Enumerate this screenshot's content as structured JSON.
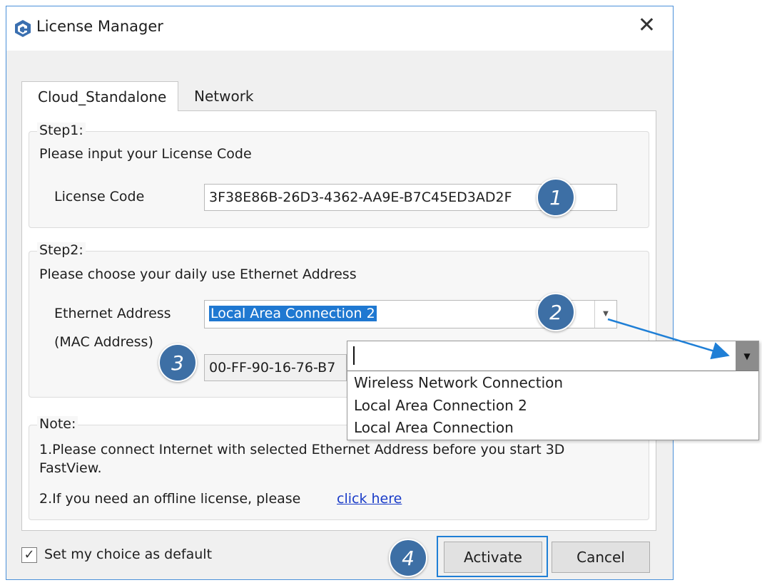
{
  "window": {
    "title": "License Manager",
    "close_icon": "close-icon"
  },
  "tabs": [
    {
      "label": "Cloud_Standalone",
      "active": true
    },
    {
      "label": "Network",
      "active": false
    }
  ],
  "step1": {
    "legend": "Step1:",
    "instruction": "Please input your License Code",
    "license_label": "License Code",
    "license_value": "3F38E86B-26D3-4362-AA9E-B7C45ED3AD2F"
  },
  "step2": {
    "legend": "Step2:",
    "instruction": "Please choose your daily use Ethernet Address",
    "ethernet_label": "Ethernet Address",
    "mac_label": "(MAC Address)",
    "ethernet_selected": "Local Area Connection 2",
    "mac_value": "00-FF-90-16-76-B7"
  },
  "dropdown": {
    "input_value": "",
    "options": [
      "Wireless Network Connection",
      "Local Area Connection 2",
      "Local Area Connection"
    ]
  },
  "note": {
    "legend": "Note:",
    "line1": "1.Please connect Internet with selected Ethernet Address before you start 3D",
    "line1b": "FastView.",
    "line2": "2.If you need an offline license, please",
    "link": "click here"
  },
  "footer": {
    "checkbox_label": "Set my choice as default",
    "checkbox_checked": true,
    "activate_label": "Activate",
    "cancel_label": "Cancel"
  },
  "badges": [
    "1",
    "2",
    "3",
    "4"
  ],
  "colors": {
    "badge": "#3d6fa5",
    "selection": "#1f78d1",
    "link": "#1a3cc8",
    "focus": "#1f7fd6",
    "arrow": "#1f7fd6"
  }
}
